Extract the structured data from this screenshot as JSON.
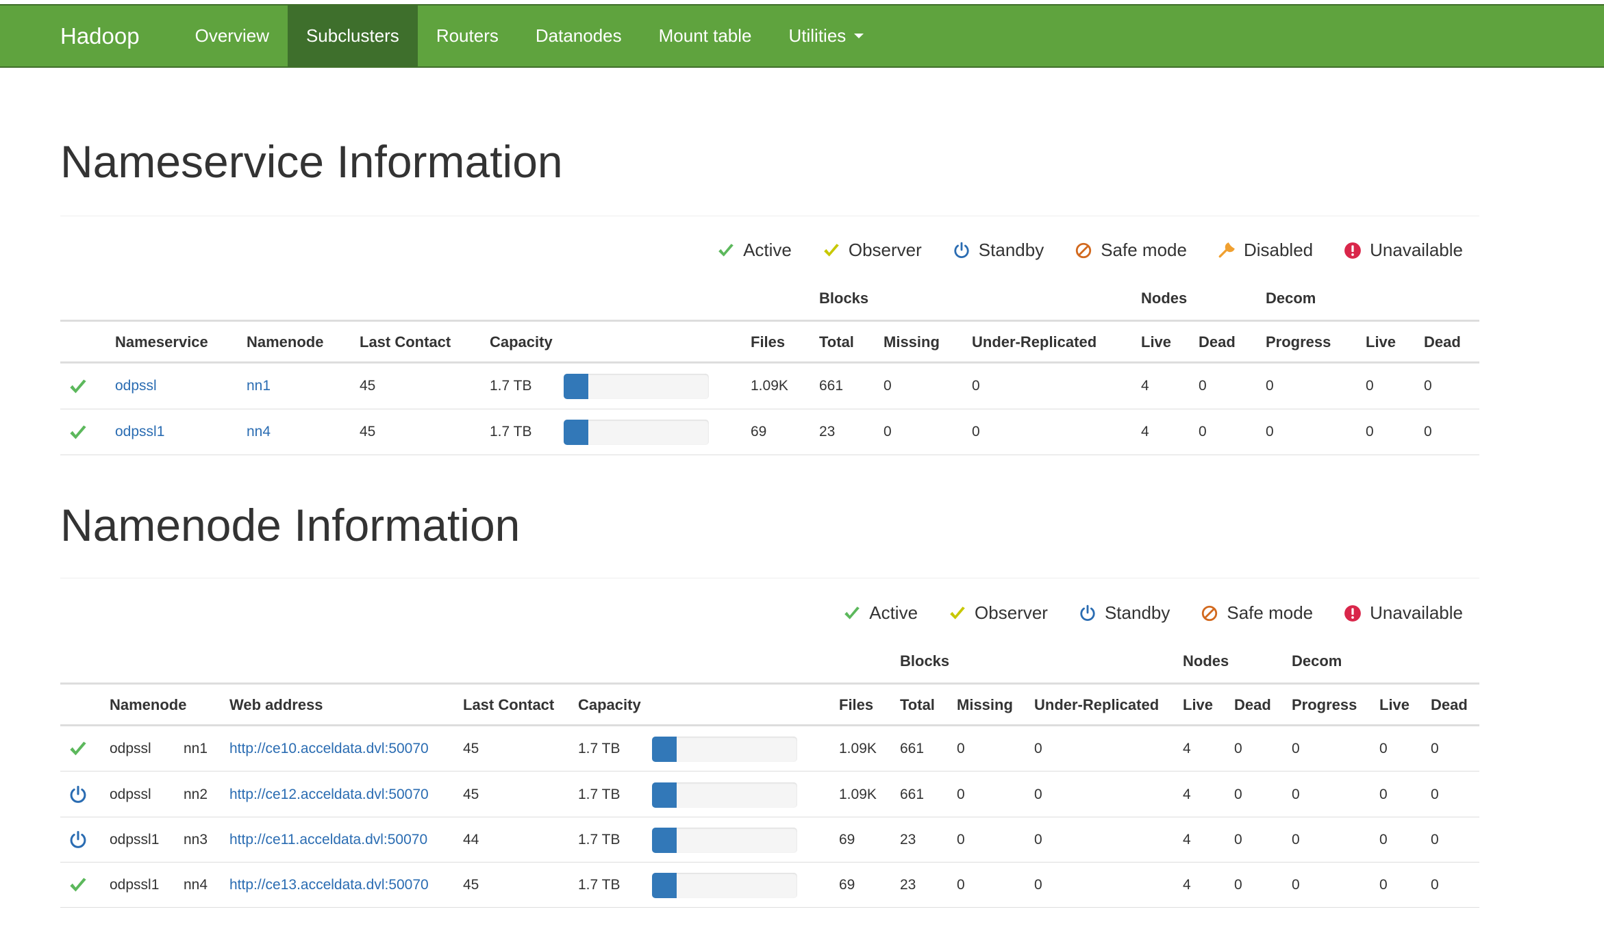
{
  "navbar": {
    "brand": "Hadoop",
    "items": [
      {
        "label": "Overview"
      },
      {
        "label": "Subclusters",
        "active": true
      },
      {
        "label": "Routers"
      },
      {
        "label": "Datanodes"
      },
      {
        "label": "Mount table"
      },
      {
        "label": "Utilities"
      }
    ],
    "bg_color": "#5fa33e",
    "active_color": "#3e6f2c"
  },
  "nameservice": {
    "title": "Nameservice Information",
    "legend": [
      {
        "icon": "check-icon",
        "label": "Active",
        "color": "#5cb85c"
      },
      {
        "icon": "observer-check-icon",
        "label": "Observer",
        "color": "#c8c800"
      },
      {
        "icon": "power-icon",
        "label": "Standby",
        "color": "#2a6cb2"
      },
      {
        "icon": "ban-icon",
        "label": "Safe mode",
        "color": "#d2691e"
      },
      {
        "icon": "wrench-icon",
        "label": "Disabled",
        "color": "#f0a030"
      },
      {
        "icon": "exclamation-icon",
        "label": "Unavailable",
        "color": "#d9264a"
      }
    ],
    "groups": {
      "blocks": "Blocks",
      "nodes": "Nodes",
      "decom": "Decom"
    },
    "columns": [
      "Nameservice",
      "Namenode",
      "Last Contact",
      "Capacity",
      "Files",
      "Total",
      "Missing",
      "Under-Replicated",
      "Live",
      "Dead",
      "Progress",
      "Live",
      "Dead"
    ],
    "rows": [
      {
        "state": "active",
        "nameservice": "odpssl",
        "namenode": "nn1",
        "last_contact": "45",
        "capacity": "1.7 TB",
        "capacity_used_pct": 17,
        "files": "1.09K",
        "total": "661",
        "missing": "0",
        "under_replicated": "0",
        "nodes_live": "4",
        "nodes_dead": "0",
        "decom_progress": "0",
        "decom_live": "0",
        "decom_dead": "0"
      },
      {
        "state": "active",
        "nameservice": "odpssl1",
        "namenode": "nn4",
        "last_contact": "45",
        "capacity": "1.7 TB",
        "capacity_used_pct": 17,
        "files": "69",
        "total": "23",
        "missing": "0",
        "under_replicated": "0",
        "nodes_live": "4",
        "nodes_dead": "0",
        "decom_progress": "0",
        "decom_live": "0",
        "decom_dead": "0"
      }
    ]
  },
  "namenode": {
    "title": "Namenode Information",
    "legend": [
      {
        "icon": "check-icon",
        "label": "Active",
        "color": "#5cb85c"
      },
      {
        "icon": "observer-check-icon",
        "label": "Observer",
        "color": "#c8c800"
      },
      {
        "icon": "power-icon",
        "label": "Standby",
        "color": "#2a6cb2"
      },
      {
        "icon": "ban-icon",
        "label": "Safe mode",
        "color": "#d2691e"
      },
      {
        "icon": "exclamation-icon",
        "label": "Unavailable",
        "color": "#d9264a"
      }
    ],
    "groups": {
      "blocks": "Blocks",
      "nodes": "Nodes",
      "decom": "Decom"
    },
    "columns": [
      "Namenode",
      "Web address",
      "Last Contact",
      "Capacity",
      "Files",
      "Total",
      "Missing",
      "Under-Replicated",
      "Live",
      "Dead",
      "Progress",
      "Live",
      "Dead"
    ],
    "rows": [
      {
        "state": "active",
        "nameservice": "odpssl",
        "namenode": "nn1",
        "web_address": "http://ce10.acceldata.dvl:50070",
        "last_contact": "45",
        "capacity": "1.7 TB",
        "capacity_used_pct": 17,
        "files": "1.09K",
        "total": "661",
        "missing": "0",
        "under_replicated": "0",
        "nodes_live": "4",
        "nodes_dead": "0",
        "decom_progress": "0",
        "decom_live": "0",
        "decom_dead": "0"
      },
      {
        "state": "standby",
        "nameservice": "odpssl",
        "namenode": "nn2",
        "web_address": "http://ce12.acceldata.dvl:50070",
        "last_contact": "45",
        "capacity": "1.7 TB",
        "capacity_used_pct": 17,
        "files": "1.09K",
        "total": "661",
        "missing": "0",
        "under_replicated": "0",
        "nodes_live": "4",
        "nodes_dead": "0",
        "decom_progress": "0",
        "decom_live": "0",
        "decom_dead": "0"
      },
      {
        "state": "standby",
        "nameservice": "odpssl1",
        "namenode": "nn3",
        "web_address": "http://ce11.acceldata.dvl:50070",
        "last_contact": "44",
        "capacity": "1.7 TB",
        "capacity_used_pct": 17,
        "files": "69",
        "total": "23",
        "missing": "0",
        "under_replicated": "0",
        "nodes_live": "4",
        "nodes_dead": "0",
        "decom_progress": "0",
        "decom_live": "0",
        "decom_dead": "0"
      },
      {
        "state": "active",
        "nameservice": "odpssl1",
        "namenode": "nn4",
        "web_address": "http://ce13.acceldata.dvl:50070",
        "last_contact": "45",
        "capacity": "1.7 TB",
        "capacity_used_pct": 17,
        "files": "69",
        "total": "23",
        "missing": "0",
        "under_replicated": "0",
        "nodes_live": "4",
        "nodes_dead": "0",
        "decom_progress": "0",
        "decom_live": "0",
        "decom_dead": "0"
      }
    ]
  }
}
